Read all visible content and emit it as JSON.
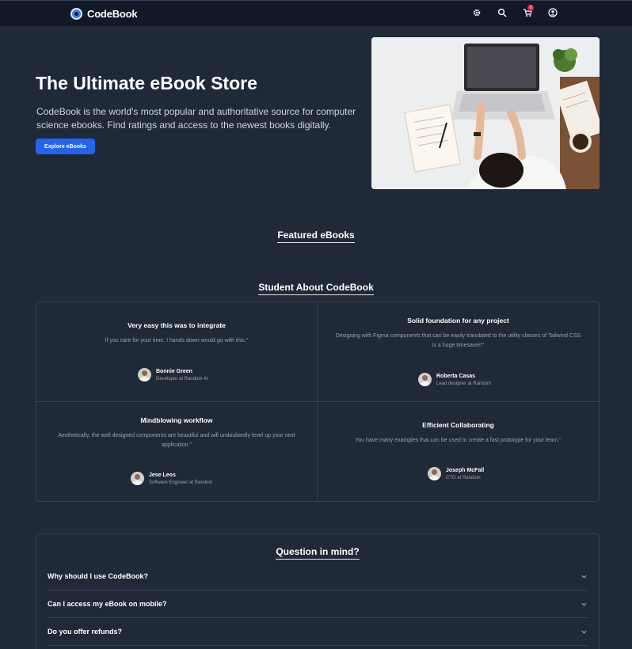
{
  "header": {
    "brand_name": "CodeBook",
    "icons": [
      "gear-icon",
      "search-icon",
      "cart-icon",
      "user-icon"
    ],
    "cart_count": "0"
  },
  "hero": {
    "title": "The Ultimate eBook Store",
    "description": "CodeBook is the world's most popular and authoritative source for computer science ebooks. Find ratings and access to the newest books digitally.",
    "cta_label": "Explore eBooks"
  },
  "featured": {
    "title": "Featured eBooks"
  },
  "testimonials": {
    "title": "Student About CodeBook",
    "items": [
      {
        "title": "Very easy this was to integrate",
        "quote": "If you care for your time, I hands down would go with this.\"",
        "name": "Bonnie Green",
        "role": "Developer at Random AI"
      },
      {
        "title": "Solid foundation for any project",
        "quote": "Designing with Figma components that can be easily translated to the utility classes of Tailwind CSS is a huge timesaver!\"",
        "name": "Roberta Casas",
        "role": "Lead designer at Random"
      },
      {
        "title": "Mindblowing workflow",
        "quote": "Aesthetically, the well designed components are beautiful and will undoubtedly level up your next application.\"",
        "name": "Jese Leos",
        "role": "Software Engineer at Random"
      },
      {
        "title": "Efficient Collaborating",
        "quote": "You have many examples that can be used to create a fast prototype for your team.\"",
        "name": "Joseph McFall",
        "role": "CTO at Random"
      }
    ]
  },
  "faq": {
    "title": "Question in mind?",
    "items": [
      {
        "question": "Why should I use CodeBook?"
      },
      {
        "question": "Can I access my eBook on mobile?"
      },
      {
        "question": "Do you offer refunds?"
      }
    ]
  },
  "colors": {
    "background": "#1f2937",
    "navbar": "#111827",
    "accent": "#2563eb",
    "border": "#374151"
  }
}
